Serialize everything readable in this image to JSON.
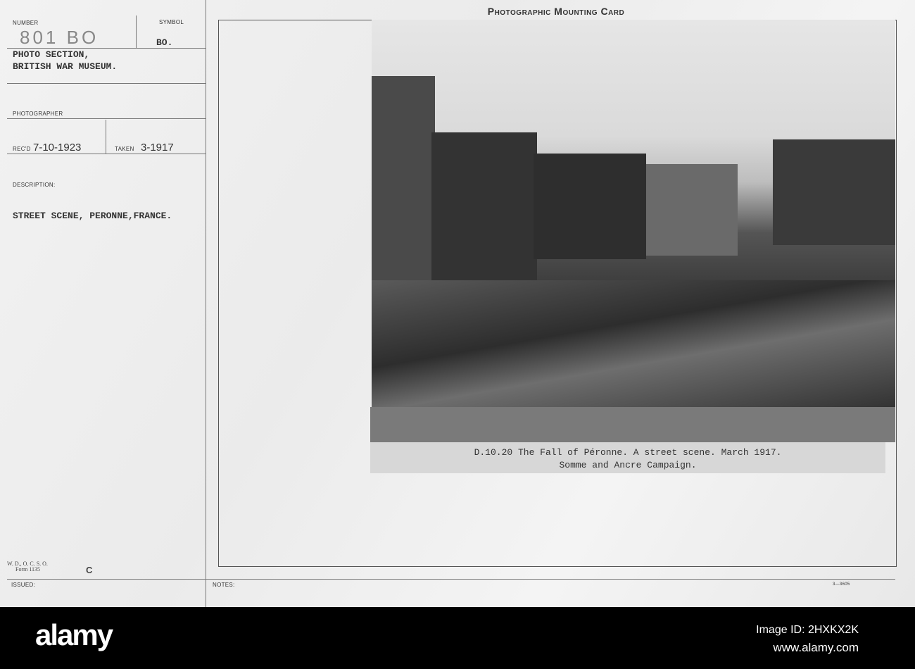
{
  "card": {
    "title": "Photographic Mounting Card",
    "number_label": "NUMBER",
    "number_value": "801 BO",
    "symbol_label": "SYMBOL",
    "symbol_value": "BO.",
    "source_line1": "PHOTO SECTION,",
    "source_line2": "BRITISH WAR MUSEUM.",
    "photographer_label": "PHOTOGRAPHER",
    "recd_label": "REC'D",
    "recd_value": "7-10-1923",
    "taken_label": "TAKEN",
    "taken_value": "3-1917",
    "description_label": "DESCRIPTION:",
    "description_value": "STREET SCENE, PERONNE,FRANCE.",
    "form_line1": "W. D., O. C. S. O.",
    "form_line2": "Form 1135",
    "form_letter": "C",
    "issued_label": "ISSUED:",
    "notes_label": "NOTES:",
    "print_code": "3—3605"
  },
  "photo": {
    "caption_line1": "D.10.20   The Fall of Péronne. A street scene. March 1917.",
    "caption_line2": "Somme and Ancre Campaign."
  },
  "watermark": {
    "logo": "alamy",
    "image_id": "Image ID: 2HXKX2K",
    "url": "www.alamy.com"
  }
}
